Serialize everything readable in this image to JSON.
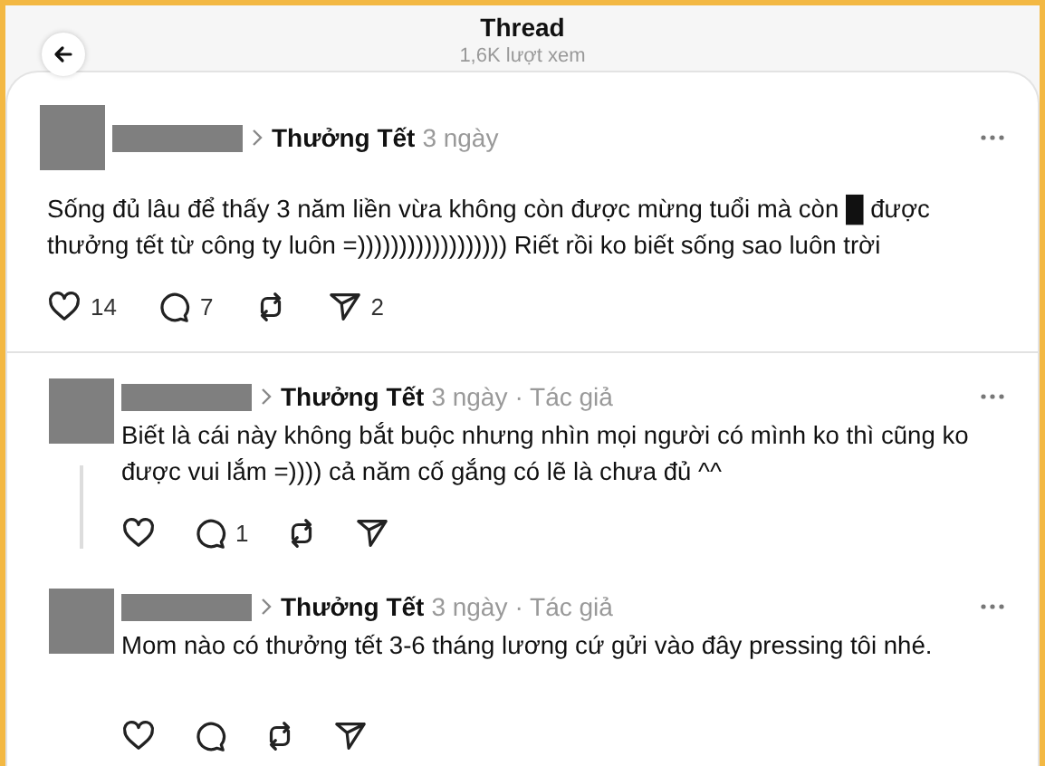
{
  "header": {
    "title": "Thread",
    "views": "1,6K lượt xem"
  },
  "posts": [
    {
      "kind": "main",
      "topic": "Thưởng Tết",
      "time": "3 ngày",
      "text": "Sống đủ lâu để thấy 3 năm liền vừa không còn được mừng tuổi mà còn █ được thưởng tết từ công ty luôn =)))))))))))))))))) Riết rồi ko biết sống sao luôn trời",
      "actions": [
        {
          "kind": "like",
          "count": "14"
        },
        {
          "kind": "comment",
          "count": "7"
        },
        {
          "kind": "repost"
        },
        {
          "kind": "share",
          "count": "2"
        }
      ]
    },
    {
      "kind": "reply",
      "topic": "Thưởng Tết",
      "time": "3 ngày",
      "badge": "· Tác giả",
      "text": "Biết là cái này không bắt buộc nhưng nhìn mọi người có mình ko thì cũng ko được vui lắm =)))) cả năm cố gắng có lẽ là chưa đủ ^^",
      "thread_line": true,
      "actions": [
        {
          "kind": "like"
        },
        {
          "kind": "comment",
          "count": "1"
        },
        {
          "kind": "repost"
        },
        {
          "kind": "share"
        }
      ]
    },
    {
      "kind": "reply",
      "topic": "Thưởng Tết",
      "time": "3 ngày",
      "badge": "· Tác giả",
      "text": "Mom nào có thưởng tết 3-6 tháng lương cứ gửi vào đây pressing tôi nhé.",
      "thread_line": false,
      "actions": [
        {
          "kind": "like"
        },
        {
          "kind": "comment"
        },
        {
          "kind": "repost"
        },
        {
          "kind": "share"
        }
      ]
    }
  ]
}
